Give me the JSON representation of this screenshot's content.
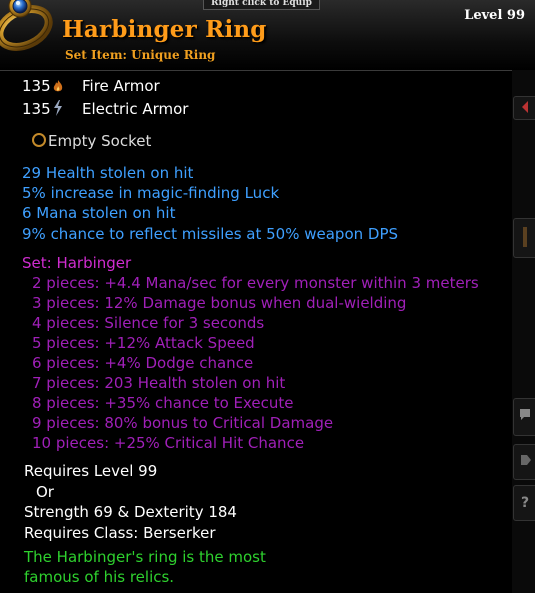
{
  "hint": "Right click to Equip",
  "item": {
    "name": "Harbinger Ring",
    "type": "Set Item: Unique Ring",
    "level": "Level 99",
    "colors": {
      "title": "#ff9c1a",
      "magic_stat": "#3fa0ff",
      "set_title": "#d02cd0",
      "set_piece": "#a020b8",
      "flavor": "#2ed02e"
    }
  },
  "armor": [
    {
      "value": "135",
      "icon": "fire-icon",
      "label": "Fire Armor"
    },
    {
      "value": "135",
      "icon": "lightning-icon",
      "label": "Electric Armor"
    }
  ],
  "socket": {
    "icon": "socket-ring-icon",
    "label": "Empty Socket"
  },
  "stats": [
    "29 Health stolen on hit",
    "5% increase in magic-finding Luck",
    "6 Mana stolen on hit",
    "9% chance to reflect missiles at 50% weapon DPS"
  ],
  "set": {
    "title": "Set: Harbinger",
    "pieces": [
      "2 pieces: +4.4 Mana/sec for every monster within 3 meters",
      "3 pieces: 12% Damage bonus when dual-wielding",
      "4 pieces: Silence for 3 seconds",
      "5 pieces: +12% Attack Speed",
      "6 pieces: +4% Dodge chance",
      "7 pieces: 203 Health stolen on hit",
      "8 pieces: +35% chance to Execute",
      "9 pieces: 80% bonus to Critical Damage",
      "10 pieces: +25% Critical Hit Chance"
    ]
  },
  "requirements": {
    "level": "Requires Level 99",
    "or": "Or",
    "stats": "Strength 69 & Dexterity 184",
    "class": "Requires Class: Berserker"
  },
  "flavor": [
    "The Harbinger's ring is the most",
    "famous of his relics."
  ]
}
